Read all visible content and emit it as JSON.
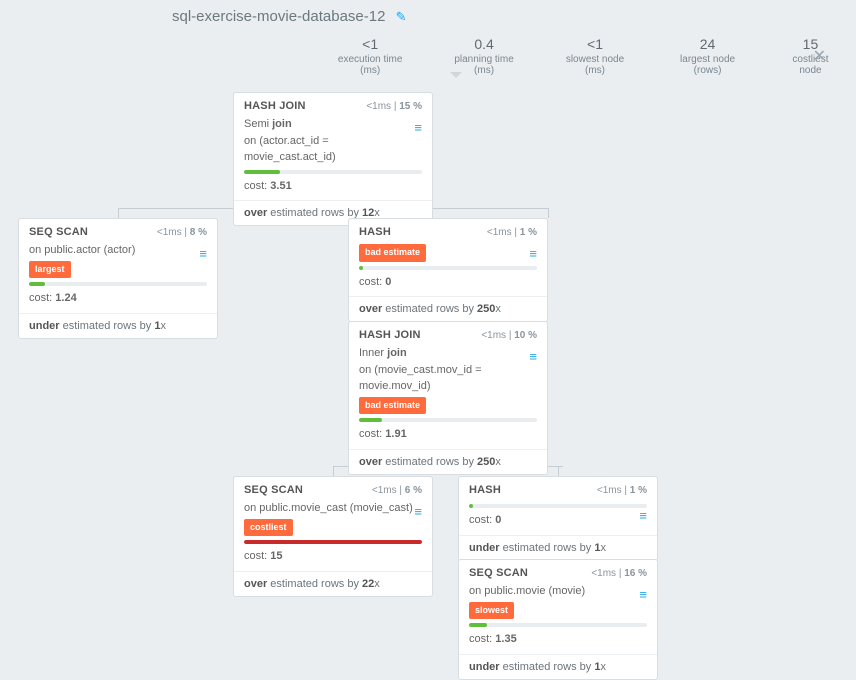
{
  "title": "sql-exercise-movie-database-12",
  "stats": [
    {
      "val": "<1",
      "lbl": "execution time (ms)"
    },
    {
      "val": "0.4",
      "lbl": "planning time (ms)"
    },
    {
      "val": "<1",
      "lbl": "slowest node (ms)"
    },
    {
      "val": "24",
      "lbl": "largest node (rows)"
    },
    {
      "val": "15",
      "lbl": "costliest node"
    }
  ],
  "nodes": {
    "n1": {
      "op": "HASH JOIN",
      "time": "<1ms",
      "pct": "15 %",
      "detail_pre": "Semi ",
      "detail_b": "join",
      "detail_post": "",
      "sub": "on (actor.act_id = movie_cast.act_id)",
      "cost_lbl": "cost:",
      "cost": "3.51",
      "est_pre": "over",
      "est_mid": " estimated rows by ",
      "est_x": "12",
      "est_suf": "x",
      "bar_w": "20%",
      "bar_class": "green"
    },
    "n2": {
      "op": "SEQ SCAN",
      "time": "<1ms",
      "pct": "8 %",
      "sub": "on public.actor (actor)",
      "badge": "largest",
      "cost_lbl": "cost:",
      "cost": "1.24",
      "est_pre": "under",
      "est_mid": " estimated rows by ",
      "est_x": "1",
      "est_suf": "x",
      "bar_w": "9%",
      "bar_class": "green"
    },
    "n3": {
      "op": "HASH",
      "time": "<1ms",
      "pct": "1 %",
      "badge": "bad estimate",
      "cost_lbl": "cost:",
      "cost": "0",
      "est_pre": "over",
      "est_mid": " estimated rows by ",
      "est_x": "250",
      "est_suf": "x",
      "bar_w": "2%",
      "bar_class": "green"
    },
    "n4": {
      "op": "HASH JOIN",
      "time": "<1ms",
      "pct": "10 %",
      "detail_pre": "Inner ",
      "detail_b": "join",
      "detail_post": "",
      "sub": "on (movie_cast.mov_id = movie.mov_id)",
      "badge": "bad estimate",
      "cost_lbl": "cost:",
      "cost": "1.91",
      "est_pre": "over",
      "est_mid": " estimated rows by ",
      "est_x": "250",
      "est_suf": "x",
      "bar_w": "13%",
      "bar_class": "green"
    },
    "n5": {
      "op": "SEQ SCAN",
      "time": "<1ms",
      "pct": "6 %",
      "sub": "on public.movie_cast (movie_cast)",
      "badge": "costliest",
      "cost_lbl": "cost:",
      "cost": "15",
      "est_pre": "over",
      "est_mid": " estimated rows by ",
      "est_x": "22",
      "est_suf": "x",
      "bar_w": "100%",
      "bar_class": "red"
    },
    "n6": {
      "op": "HASH",
      "time": "<1ms",
      "pct": "1 %",
      "cost_lbl": "cost:",
      "cost": "0",
      "est_pre": "under",
      "est_mid": " estimated rows by ",
      "est_x": "1",
      "est_suf": "x",
      "bar_w": "2%",
      "bar_class": "green"
    },
    "n7": {
      "op": "SEQ SCAN",
      "time": "<1ms",
      "pct": "16 %",
      "sub": "on public.movie (movie)",
      "badge": "slowest",
      "cost_lbl": "cost:",
      "cost": "1.35",
      "est_pre": "under",
      "est_mid": " estimated rows by ",
      "est_x": "1",
      "est_suf": "x",
      "bar_w": "10%",
      "bar_class": "green"
    }
  }
}
